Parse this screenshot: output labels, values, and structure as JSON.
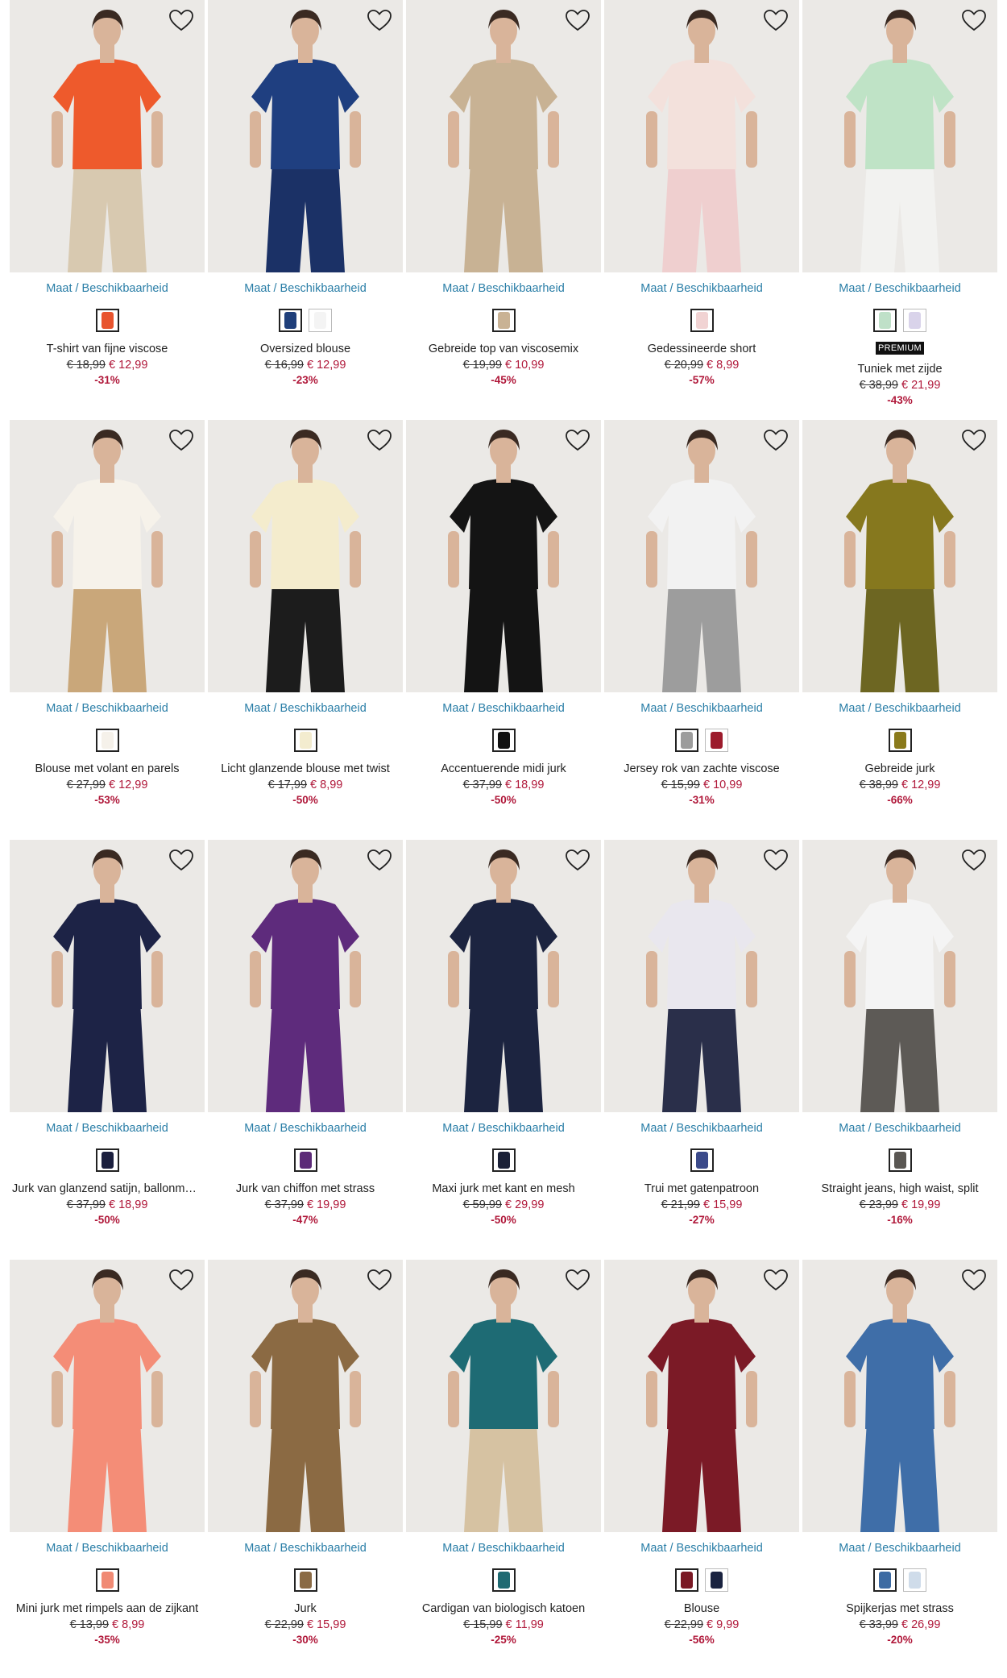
{
  "size_link_label": "Maat / Beschikbaarheid",
  "premium_label": "PREMIUM",
  "products": [
    {
      "name": "T-shirt van fijne viscose",
      "old_price": "€ 18,99",
      "new_price": "€ 12,99",
      "discount": "-31%",
      "swatches": [
        "#e8542e"
      ],
      "garment": "#ee5a2c",
      "pants": "#d8c9b0",
      "premium": false
    },
    {
      "name": "Oversized blouse",
      "old_price": "€ 16,99",
      "new_price": "€ 12,99",
      "discount": "-23%",
      "swatches": [
        "#1f3f7a",
        "#f4f4f4"
      ],
      "garment": "#1f3f80",
      "pants": "#1b3166",
      "premium": false
    },
    {
      "name": "Gebreide top van viscosemix",
      "old_price": "€ 19,99",
      "new_price": "€ 10,99",
      "discount": "-45%",
      "swatches": [
        "#c9b294"
      ],
      "garment": "#c8b294",
      "pants": "#c8b294",
      "premium": false
    },
    {
      "name": "Gedessineerde short",
      "old_price": "€ 20,99",
      "new_price": "€ 8,99",
      "discount": "-57%",
      "swatches": [
        "#f1d3d3"
      ],
      "garment": "#f3e1dc",
      "pants": "#efcfcf",
      "premium": false
    },
    {
      "name": "Tuniek met zijde",
      "old_price": "€ 38,99",
      "new_price": "€ 21,99",
      "discount": "-43%",
      "swatches": [
        "#bfe0c8",
        "#d9d3ea"
      ],
      "garment": "#bfe3c6",
      "pants": "#f2f2f0",
      "premium": true
    },
    {
      "name": "Blouse met volant en parels",
      "old_price": "€ 27,99",
      "new_price": "€ 12,99",
      "discount": "-53%",
      "swatches": [
        "#f5f1ea"
      ],
      "garment": "#f6f2ea",
      "pants": "#c9a77a",
      "premium": false
    },
    {
      "name": "Licht glanzende blouse met twist",
      "old_price": "€ 17,99",
      "new_price": "€ 8,99",
      "discount": "-50%",
      "swatches": [
        "#f3eccf"
      ],
      "garment": "#f4eccd",
      "pants": "#1c1c1c",
      "premium": false
    },
    {
      "name": "Accentuerende midi jurk",
      "old_price": "€ 37,99",
      "new_price": "€ 18,99",
      "discount": "-50%",
      "swatches": [
        "#111111"
      ],
      "garment": "#141414",
      "pants": "#141414",
      "premium": false
    },
    {
      "name": "Jersey rok van zachte viscose",
      "old_price": "€ 15,99",
      "new_price": "€ 10,99",
      "discount": "-31%",
      "swatches": [
        "#9c9c9c",
        "#9c1b2c"
      ],
      "garment": "#f2f2f2",
      "pants": "#9d9d9d",
      "premium": false
    },
    {
      "name": "Gebreide jurk",
      "old_price": "€ 38,99",
      "new_price": "€ 12,99",
      "discount": "-66%",
      "swatches": [
        "#8a7a1c"
      ],
      "garment": "#86781e",
      "pants": "#6d6622",
      "premium": false
    },
    {
      "name": "Jurk van glanzend satijn, ballonmodel",
      "old_price": "€ 37,99",
      "new_price": "€ 18,99",
      "discount": "-50%",
      "swatches": [
        "#1b1f3e"
      ],
      "garment": "#1d2346",
      "pants": "#1d2346",
      "premium": false
    },
    {
      "name": "Jurk van chiffon met strass",
      "old_price": "€ 37,99",
      "new_price": "€ 19,99",
      "discount": "-47%",
      "swatches": [
        "#5c2a78"
      ],
      "garment": "#5e2b7c",
      "pants": "#5e2b7c",
      "premium": false
    },
    {
      "name": "Maxi jurk met kant en mesh",
      "old_price": "€ 59,99",
      "new_price": "€ 29,99",
      "discount": "-50%",
      "swatches": [
        "#1b2138"
      ],
      "garment": "#1c2440",
      "pants": "#1c2440",
      "premium": false
    },
    {
      "name": "Trui met gatenpatroon",
      "old_price": "€ 21,99",
      "new_price": "€ 15,99",
      "discount": "-27%",
      "swatches": [
        "#3b4a8a"
      ],
      "garment": "#e9e7ee",
      "pants": "#2a2f4a",
      "premium": false
    },
    {
      "name": "Straight jeans, high waist, split",
      "old_price": "€ 23,99",
      "new_price": "€ 19,99",
      "discount": "-16%",
      "swatches": [
        "#5a5753"
      ],
      "garment": "#f4f4f4",
      "pants": "#5d5a56",
      "premium": false
    },
    {
      "name": "Mini jurk met rimpels aan de zijkant",
      "old_price": "€ 13,99",
      "new_price": "€ 8,99",
      "discount": "-35%",
      "swatches": [
        "#f08a74"
      ],
      "garment": "#f48d77",
      "pants": "#f48d77",
      "premium": false
    },
    {
      "name": "Jurk",
      "old_price": "€ 22,99",
      "new_price": "€ 15,99",
      "discount": "-30%",
      "swatches": [
        "#8a6a44"
      ],
      "garment": "#8b6a43",
      "pants": "#8b6a43",
      "premium": false
    },
    {
      "name": "Cardigan van biologisch katoen",
      "old_price": "€ 15,99",
      "new_price": "€ 11,99",
      "discount": "-25%",
      "swatches": [
        "#1f6a72"
      ],
      "garment": "#1e6b74",
      "pants": "#d6c2a2",
      "premium": false
    },
    {
      "name": "Blouse",
      "old_price": "€ 22,99",
      "new_price": "€ 9,99",
      "discount": "-56%",
      "swatches": [
        "#7a1824",
        "#1a2340"
      ],
      "garment": "#7b1a26",
      "pants": "#7b1a26",
      "premium": false
    },
    {
      "name": "Spijkerjas met strass",
      "old_price": "€ 33,99",
      "new_price": "€ 26,99",
      "discount": "-20%",
      "swatches": [
        "#3d6ba3",
        "#cfdcea"
      ],
      "garment": "#3f6ea8",
      "pants": "#3f6ea8",
      "premium": false
    }
  ]
}
